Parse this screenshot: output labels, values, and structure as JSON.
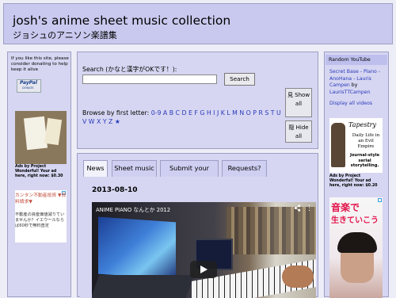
{
  "header": {
    "title": "josh's anime sheet music collection",
    "subtitle": "ジョシュのアニソン楽譜集"
  },
  "left_sidebar": {
    "donate_text": "If you like this site, please consider donating to help keep it alive",
    "paypal_label": "PayPal",
    "paypal_sub": "DONATE",
    "ad1_caption": "Ads by Project Wonderful! Your ad here, right now: $0.30",
    "ad2_text1": "カンタン不動産投資 ▼資料請求▼",
    "ad2_text2": "不動産の資産価値減りていませんか？イエウールならば60秒で無料査定"
  },
  "search": {
    "label": "Search (かなと漢字がOKです！):",
    "input_value": "",
    "button_label": "Search",
    "browse_label": "Browse by first letter:",
    "letters": "0-9 A B C D E F G H I J K L M N O P R S T U V W X Y Z ★",
    "show_all_label": "見 Show all",
    "hide_all_label": "隠 Hide all"
  },
  "tabs": [
    "News",
    "Sheet music",
    "Submit your own!",
    "Requests?"
  ],
  "post": {
    "date": "2013-08-10",
    "video_title": "ANIME PIANO なんとか 2012"
  },
  "right_sidebar": {
    "youtube_title": "Random YouTube",
    "youtube_entry": "Secret Base - Piano - AnoHana - Lauris Campen",
    "youtube_by": "by",
    "youtube_author": "LaurisTTCampen",
    "display_all": "Display all videos",
    "ad3_title": "Tapestry",
    "ad3_tagline": "Daily Life in an Evil Empire",
    "ad3_desc": "Journal-style serial storytelling.",
    "ad3_caption": "Ads by Project Wonderful! Your ad here, right now: $0.20",
    "ad4_line1": "音楽で",
    "ad4_line2": "生きていこう"
  },
  "colors": {
    "page_bg": "#ededf7",
    "panel_bg": "#d6d6f2",
    "header_bg": "#c9c9ef",
    "link": "#2a39b9"
  }
}
